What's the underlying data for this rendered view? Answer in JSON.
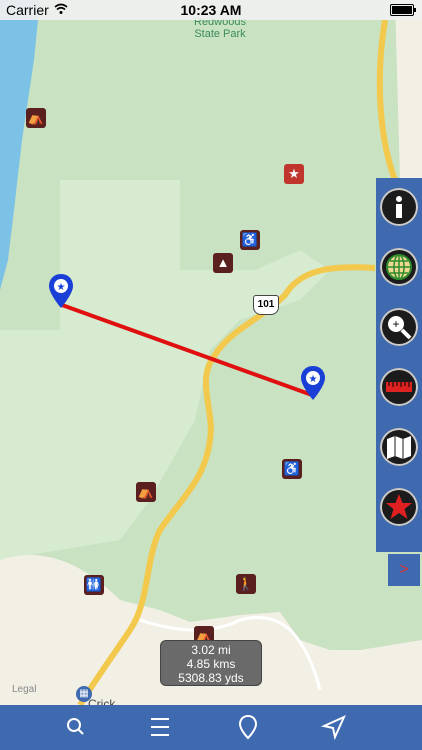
{
  "status_bar": {
    "carrier": "Carrier",
    "time": "10:23 AM"
  },
  "map": {
    "park_label": "Redwoods\nState Park",
    "highway_shield": "101",
    "legal_label": "Legal",
    "town_label": "Crick",
    "route_color": "#e01010",
    "pin_color": "#1a3fd6"
  },
  "distance_box": {
    "miles": "3.02 mi",
    "kms": "4.85 kms",
    "yds": "5308.83 yds"
  },
  "sidebar": {
    "buttons": [
      "info-icon",
      "globe-icon",
      "zoom-in-icon",
      "ruler-icon",
      "map-icon",
      "star-icon"
    ],
    "expand_label": ">"
  },
  "tab_bar": {
    "items": [
      "search-icon",
      "menu-icon",
      "location-pin-icon",
      "navigate-icon"
    ]
  }
}
